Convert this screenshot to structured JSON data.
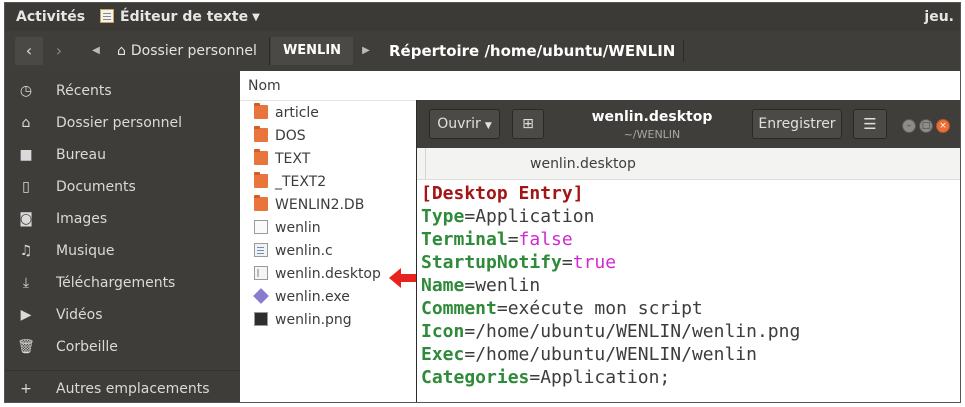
{
  "topbar": {
    "activities": "Activités",
    "app_menu": "Éditeur de texte",
    "clock": "jeu."
  },
  "nav": {
    "home_label": "Dossier personnel",
    "current_label": "WENLIN",
    "directory_title": "Répertoire /home/ubuntu/WENLIN"
  },
  "sidebar": {
    "items": [
      {
        "label": "Récents",
        "icon": "clock-icon"
      },
      {
        "label": "Dossier personnel",
        "icon": "home-icon"
      },
      {
        "label": "Bureau",
        "icon": "folder-icon"
      },
      {
        "label": "Documents",
        "icon": "document-icon"
      },
      {
        "label": "Images",
        "icon": "camera-icon"
      },
      {
        "label": "Musique",
        "icon": "music-icon"
      },
      {
        "label": "Téléchargements",
        "icon": "download-icon"
      },
      {
        "label": "Vidéos",
        "icon": "video-icon"
      },
      {
        "label": "Corbeille",
        "icon": "trash-icon"
      },
      {
        "label": "Autres emplacements",
        "icon": "plus-icon"
      }
    ]
  },
  "files": {
    "column_header": "Nom",
    "items": [
      {
        "name": "article",
        "type": "folder"
      },
      {
        "name": "DOS",
        "type": "folder"
      },
      {
        "name": "TEXT",
        "type": "folder"
      },
      {
        "name": "_TEXT2",
        "type": "folder"
      },
      {
        "name": "WENLIN2.DB",
        "type": "folder"
      },
      {
        "name": "wenlin",
        "type": "file"
      },
      {
        "name": "wenlin.c",
        "type": "c-source"
      },
      {
        "name": "wenlin.desktop",
        "type": "desktop"
      },
      {
        "name": "wenlin.exe",
        "type": "exe"
      },
      {
        "name": "wenlin.png",
        "type": "image"
      }
    ]
  },
  "editor": {
    "open_label": "Ouvrir",
    "save_label": "Enregistrer",
    "menu_icon": "hamburger-icon",
    "title": "wenlin.desktop",
    "subtitle": "~/WENLIN",
    "tab_label": "wenlin.desktop",
    "lines": [
      {
        "section": "[Desktop Entry]"
      },
      {
        "key": "Type",
        "value": "Application"
      },
      {
        "key": "Terminal",
        "value": "false"
      },
      {
        "key": "StartupNotify",
        "value": "true"
      },
      {
        "key": "Name",
        "value": "wenlin"
      },
      {
        "key": "Comment",
        "value": "exécute mon script"
      },
      {
        "key": "Icon",
        "value": "/home/ubuntu/WENLIN/wenlin.png"
      },
      {
        "key": "Exec",
        "value": "/home/ubuntu/WENLIN/wenlin"
      },
      {
        "key": "Categories",
        "value": "Application;"
      }
    ]
  },
  "colors": {
    "topbar": "#3b3a36",
    "sidebar": "#3e3d39",
    "accent_close": "#e96e38",
    "arrow": "#e8221c",
    "section": "#a31515",
    "key": "#2f8a3a",
    "boolean": "#d228d2"
  }
}
